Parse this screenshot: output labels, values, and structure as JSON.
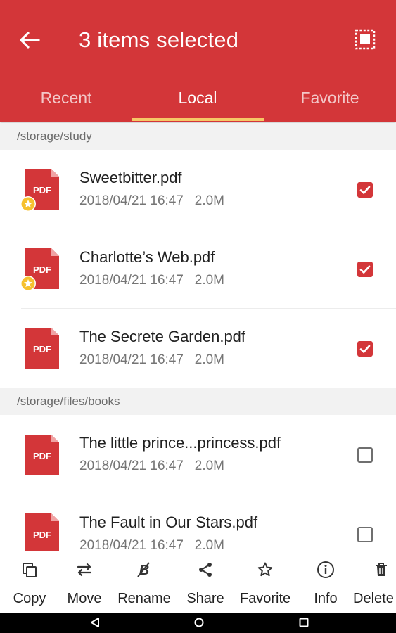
{
  "header": {
    "title": "3  items selected",
    "background": "#d33639"
  },
  "tabs": [
    {
      "label": "Recent",
      "active": false
    },
    {
      "label": "Local",
      "active": true
    },
    {
      "label": "Favorite",
      "active": false
    }
  ],
  "sections": [
    {
      "path": "/storage/study",
      "files": [
        {
          "name": "Sweetbitter.pdf",
          "date": "2018/04/21 16:47",
          "size": "2.0M",
          "favorite": true,
          "checked": true
        },
        {
          "name": "Charlotte’s Web.pdf",
          "date": "2018/04/21 16:47",
          "size": "2.0M",
          "favorite": true,
          "checked": true
        },
        {
          "name": "The Secrete Garden.pdf",
          "date": "2018/04/21 16:47",
          "size": "2.0M",
          "favorite": false,
          "checked": true
        }
      ]
    },
    {
      "path": "/storage/files/books",
      "files": [
        {
          "name": "The little prince...princess.pdf",
          "date": "2018/04/21 16:47",
          "size": "2.0M",
          "favorite": false,
          "checked": false
        },
        {
          "name": "The Fault in Our Stars.pdf",
          "date": "2018/04/21 16:47",
          "size": "2.0M",
          "favorite": false,
          "checked": false
        }
      ]
    }
  ],
  "pdf_icon_label": "PDF",
  "actions": [
    {
      "label": "Copy",
      "icon": "copy-icon"
    },
    {
      "label": "Move",
      "icon": "move-icon"
    },
    {
      "label": "Rename",
      "icon": "rename-icon"
    },
    {
      "label": "Share",
      "icon": "share-icon"
    },
    {
      "label": "Favorite",
      "icon": "star-icon"
    },
    {
      "label": "Info",
      "icon": "info-icon"
    },
    {
      "label": "Delete",
      "icon": "delete-icon"
    }
  ],
  "colors": {
    "accent": "#d33639",
    "tab_indicator": "#f6c766",
    "star_badge": "#f6c12f"
  }
}
